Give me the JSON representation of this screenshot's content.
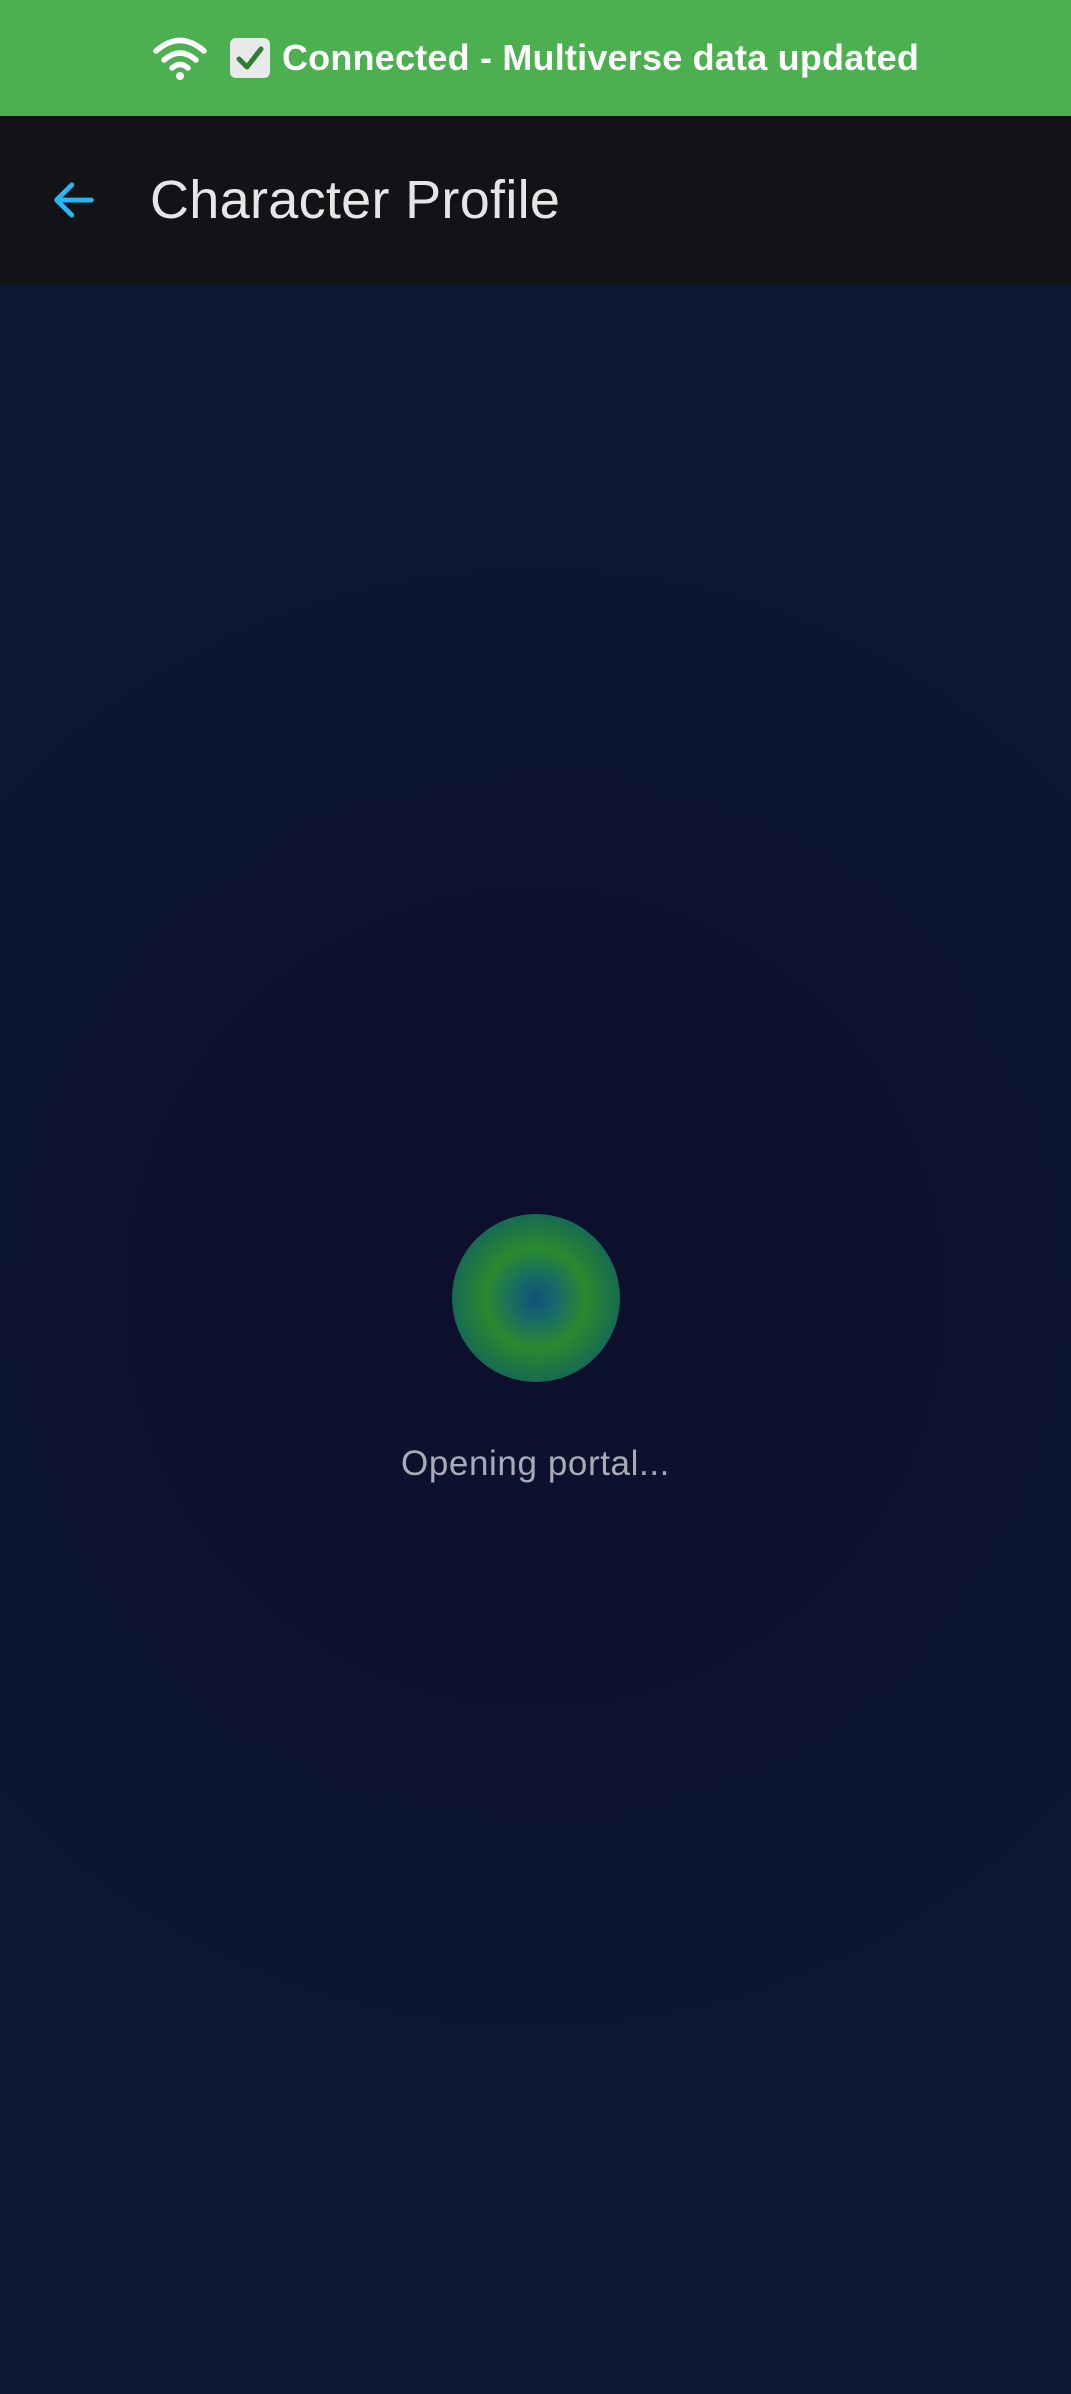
{
  "banner": {
    "icon": "wifi-icon",
    "check_icon": "check-box-icon",
    "text": "Connected - Multiverse data updated",
    "background": "#4caf50"
  },
  "app_bar": {
    "back_icon": "arrow-left-icon",
    "back_icon_color": "#29b6f6",
    "title": "Character Profile",
    "background": "#121317"
  },
  "loader": {
    "icon": "portal-spinner-icon",
    "text": "Opening portal..."
  },
  "colors": {
    "page_background": "#0b1733",
    "portal_green": "#2a8a2e",
    "portal_blue": "#124d79"
  }
}
